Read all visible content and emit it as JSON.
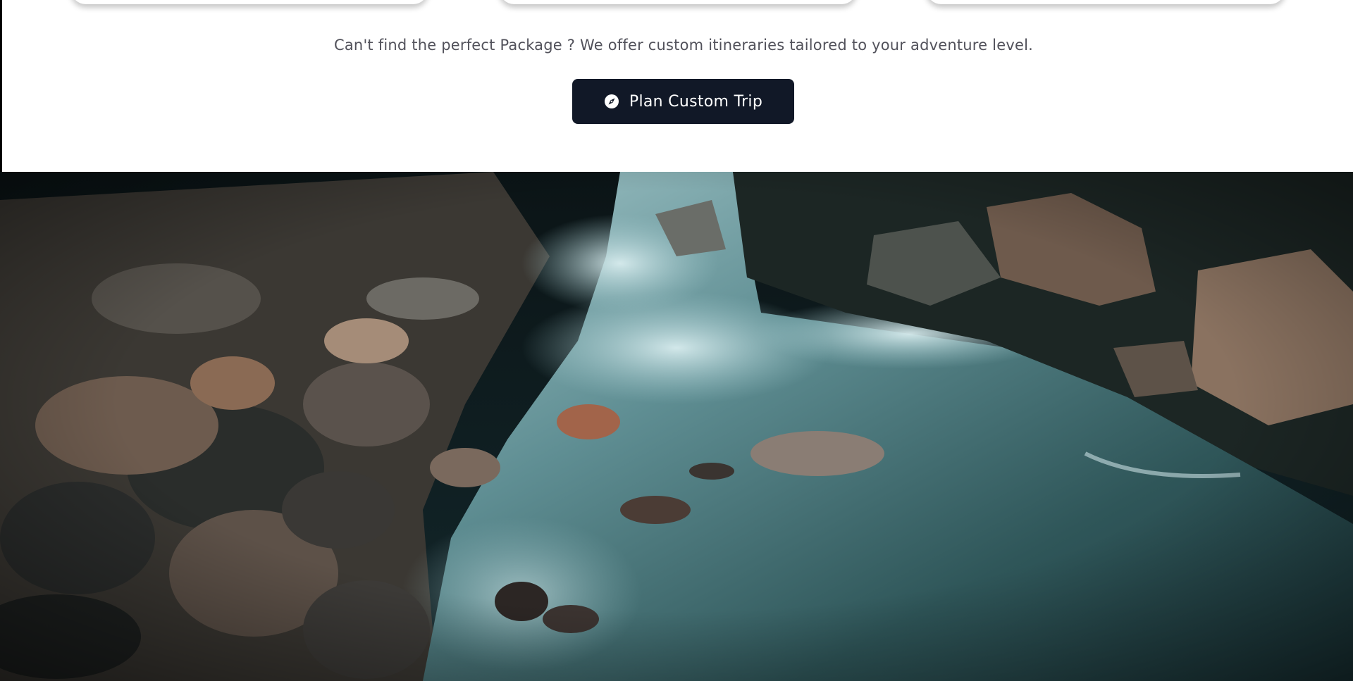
{
  "custom_trip_section": {
    "prompt_text": "Can't find the perfect Package ? We offer custom itineraries tailored to your adventure level.",
    "button_label": "Plan Custom Trip",
    "button_icon": "compass-icon"
  },
  "colors": {
    "button_background": "#111827",
    "button_text": "#ffffff",
    "prompt_text": "#52525b",
    "page_background": "#ffffff"
  }
}
